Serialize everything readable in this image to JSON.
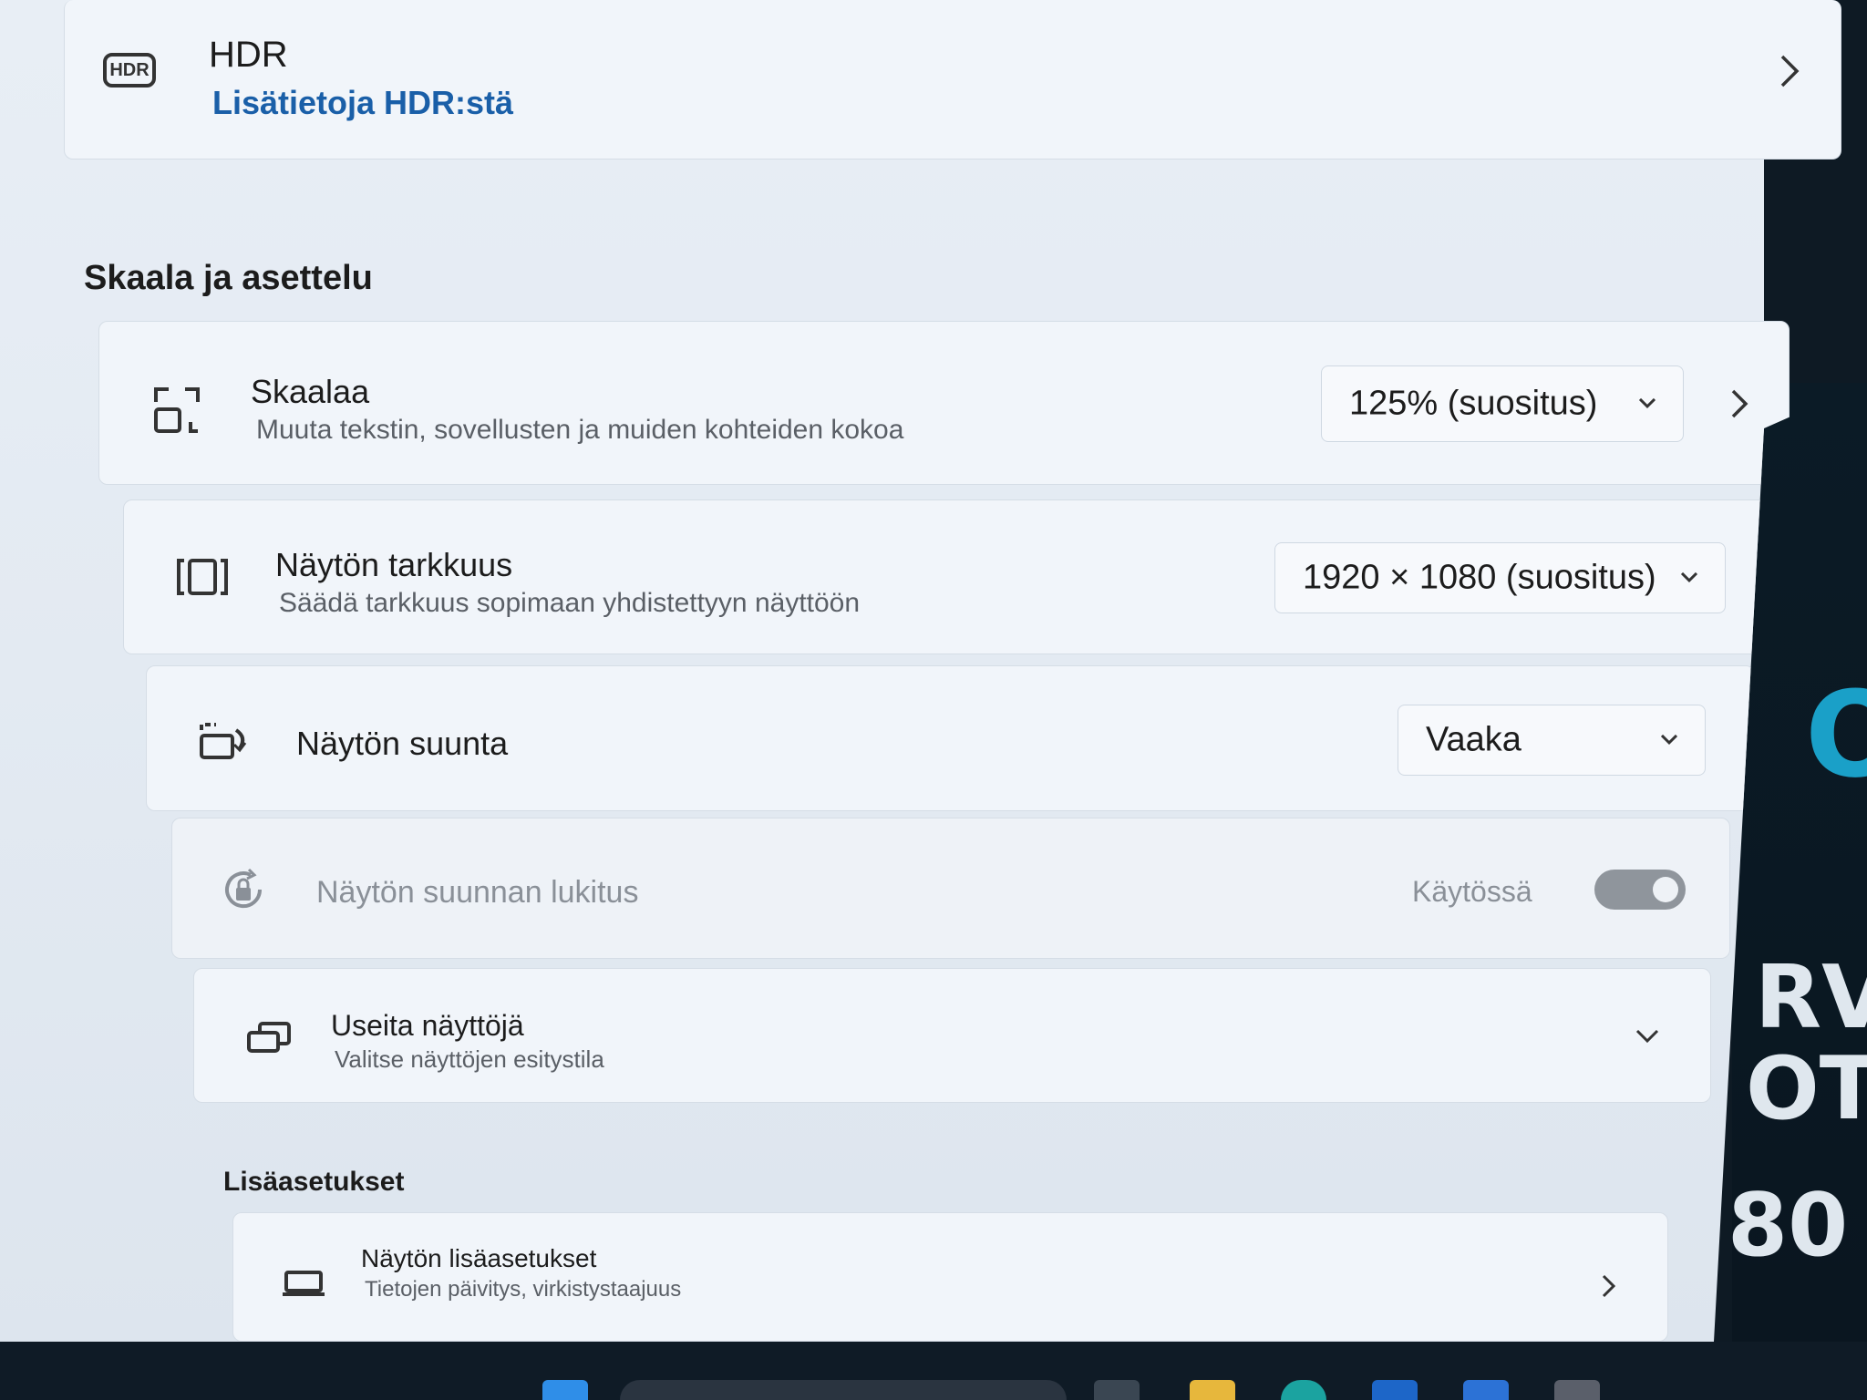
{
  "hdr_card": {
    "badge": "HDR",
    "title": "HDR",
    "link": "Lisätietoja HDR:stä"
  },
  "scale_section": {
    "heading": "Skaala ja asettelu",
    "items": [
      {
        "title": "Skaalaa",
        "subtitle": "Muuta tekstin, sovellusten ja muiden kohteiden kokoa",
        "dropdown": "125% (suositus)",
        "icon": "scale-icon"
      },
      {
        "title": "Näytön tarkkuus",
        "subtitle": "Säädä tarkkuus sopimaan yhdistettyyn näyttöön",
        "dropdown": "1920 × 1080 (suositus)",
        "icon": "resolution-icon"
      },
      {
        "title": "Näytön suunta",
        "dropdown": "Vaaka",
        "icon": "orientation-icon"
      },
      {
        "title": "Näytön suunnan lukitus",
        "state_label": "Käytössä",
        "toggle_on": true,
        "disabled": true,
        "icon": "rotation-lock-icon"
      },
      {
        "title": "Useita näyttöjä",
        "subtitle": "Valitse näyttöjen esitystila",
        "icon": "multiple-displays-icon"
      }
    ]
  },
  "advanced_section": {
    "heading": "Lisäasetukset",
    "items": [
      {
        "title": "Näytön lisäasetukset",
        "subtitle": "Tietojen päivitys, virkistystaajuus",
        "icon": "monitor-icon"
      }
    ]
  },
  "background_text": [
    "O",
    "RVI",
    "OT",
    "80"
  ],
  "colors": {
    "accent": "#1a5fa8",
    "window_bg": "#e6edf4",
    "card_bg": "#f1f5fa",
    "toggle": "#8f959c"
  }
}
